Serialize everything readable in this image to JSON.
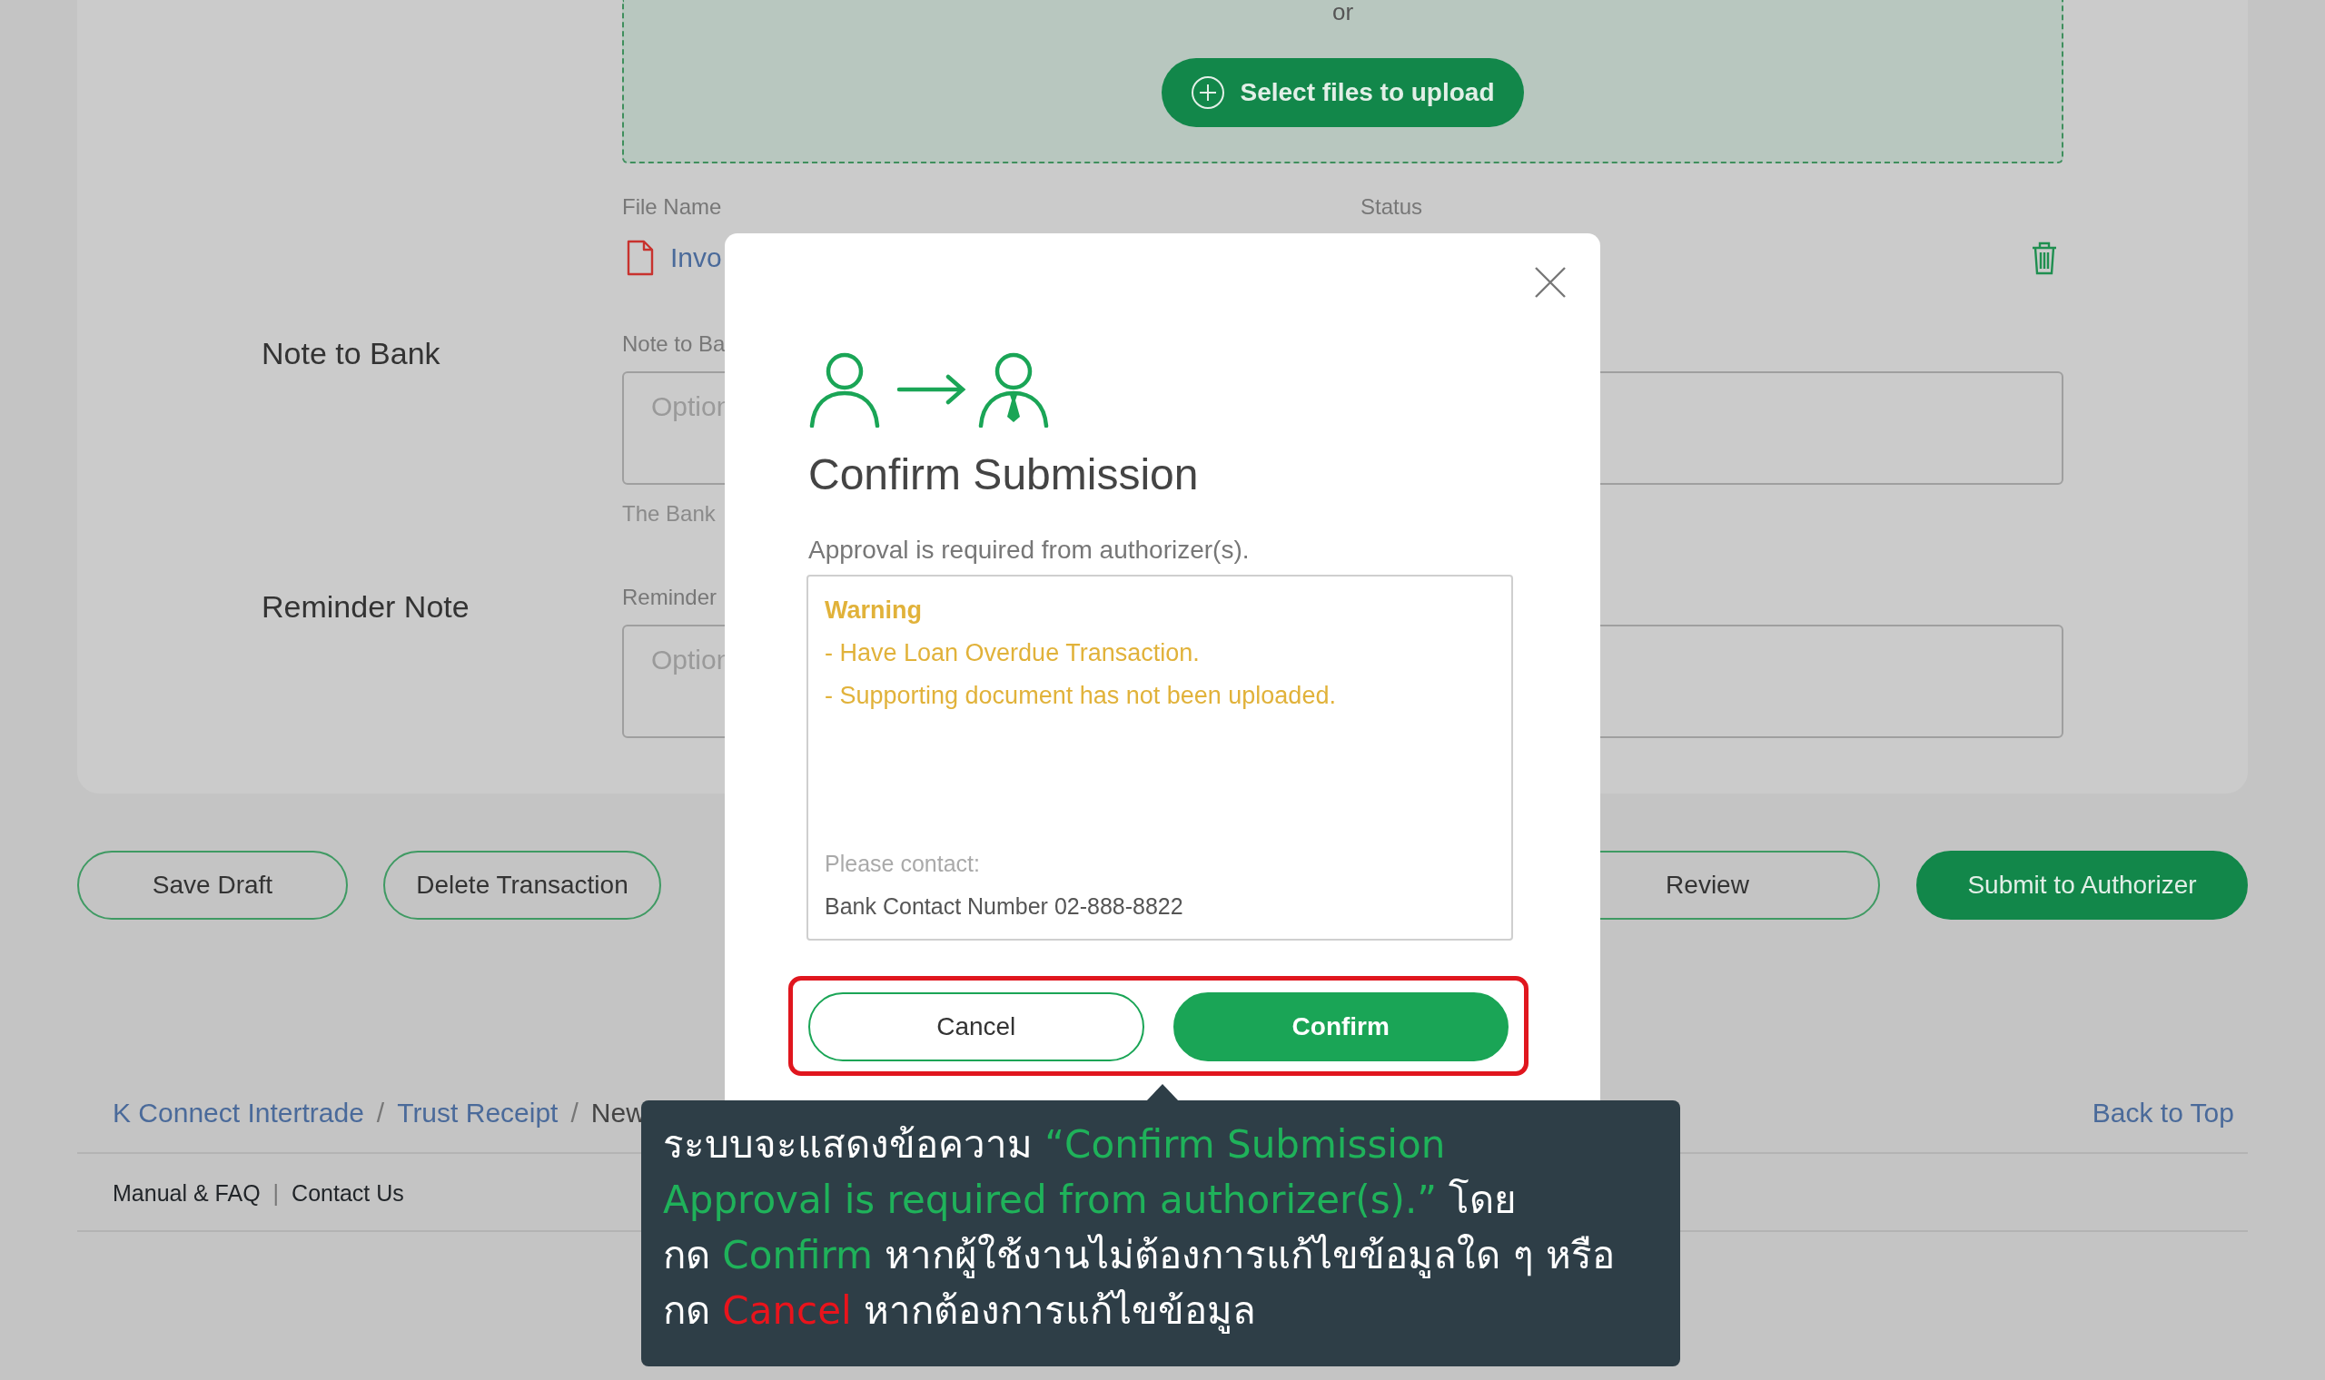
{
  "upload": {
    "separator": "or",
    "button": "Select files to upload"
  },
  "files": {
    "columns": [
      "File Name",
      "Status"
    ],
    "rows": [
      {
        "name": "Invo"
      }
    ]
  },
  "fields": [
    {
      "title": "Note to Bank",
      "label": "Note to Ba",
      "placeholder": "Option",
      "help": "The Bank"
    },
    {
      "title": "Reminder Note",
      "label": "Reminder",
      "placeholder": "Option"
    }
  ],
  "actions": [
    {
      "label": "Save Draft",
      "kind": "outline"
    },
    {
      "label": "Delete Transaction",
      "kind": "outline"
    },
    {
      "label": "Review",
      "kind": "outline"
    },
    {
      "label": "Submit to Authorizer",
      "kind": "solid"
    }
  ],
  "breadcrumb": {
    "separator": "/",
    "items": [
      {
        "label": "K Connect Intertrade",
        "current": false
      },
      {
        "label": "Trust Receipt",
        "current": false
      },
      {
        "label": "New",
        "current": true
      }
    ]
  },
  "back_to_top": "Back to Top",
  "footer": {
    "separator": "|",
    "links": [
      "Manual & FAQ",
      "Contact Us"
    ]
  },
  "modal": {
    "title": "Confirm Submission",
    "message": "Approval is required from authorizer(s).",
    "warning": {
      "heading": "Warning",
      "lines": [
        "- Have Loan Overdue Transaction.",
        "- Supporting document has not been uploaded."
      ]
    },
    "contact_label": "Please contact:",
    "contact": "Bank Contact Number 02-888-8822",
    "highlighted": true,
    "buttons": [
      {
        "label": "Cancel",
        "kind": "outline"
      },
      {
        "label": "Confirm",
        "kind": "solid"
      }
    ]
  },
  "callout": {
    "segments": [
      {
        "text": "ระบบจะแสดงข้อความ ",
        "color": "#ffffff"
      },
      {
        "text": "“Confirm Submission\nApproval is required from authorizer(s).”",
        "color": "#1fb25a"
      },
      {
        "text": " โดย\nกด ",
        "color": "#ffffff"
      },
      {
        "text": "Confirm",
        "color": "#1fb25a"
      },
      {
        "text": " หากผู้ใช้งานไม่ต้องการแก้ไขข้อมูลใด ๆ หรือ\nกด ",
        "color": "#ffffff"
      },
      {
        "text": "Cancel",
        "color": "#e8141c"
      },
      {
        "text": " หากต้องการแก้ไขข้อมูล",
        "color": "#ffffff"
      }
    ]
  }
}
